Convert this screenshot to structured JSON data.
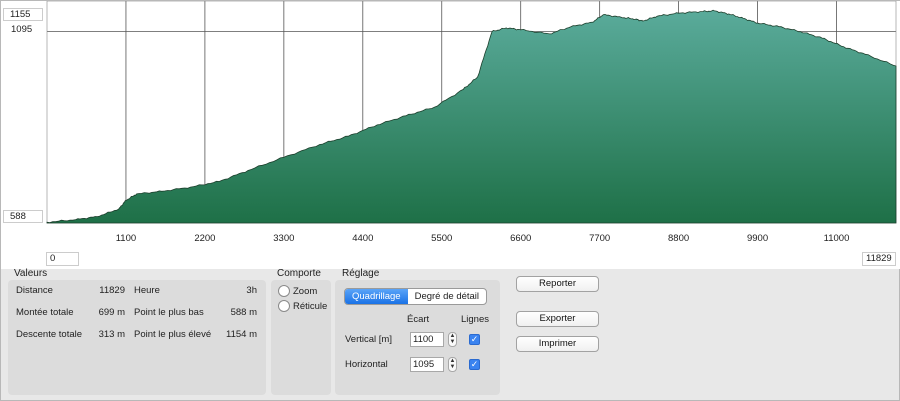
{
  "chart": {
    "y_top_label": "1155",
    "y_grid_label": "1095",
    "y_bottom_label": "588",
    "x_start_label": "0",
    "x_end_label": "11829",
    "colors": {
      "fill_top": "#5aab9b",
      "fill_bottom": "#1e7047",
      "grid": "#555555"
    }
  },
  "chart_data": {
    "type": "area",
    "xlim": [
      0,
      11829
    ],
    "ylim": [
      588,
      1155
    ],
    "x_ticks": [
      1100,
      2200,
      3300,
      4400,
      5500,
      6600,
      7700,
      8800,
      9900,
      11000
    ],
    "y_grid": [
      1095
    ],
    "grid": true,
    "x": [
      0,
      400,
      700,
      1000,
      1100,
      1250,
      1600,
      2000,
      2400,
      2800,
      3300,
      3800,
      4200,
      4600,
      5000,
      5400,
      5800,
      6000,
      6200,
      6400,
      6600,
      7000,
      7300,
      7600,
      7750,
      8000,
      8200,
      8300,
      8500,
      8800,
      9100,
      9300,
      9500,
      9700,
      9900,
      10200,
      10500,
      10800,
      11100,
      11400,
      11829
    ],
    "y": [
      590,
      597,
      605,
      625,
      648,
      665,
      672,
      683,
      698,
      727,
      762,
      796,
      818,
      848,
      872,
      895,
      942,
      975,
      1095,
      1105,
      1100,
      1089,
      1108,
      1120,
      1140,
      1133,
      1128,
      1123,
      1136,
      1144,
      1148,
      1150,
      1142,
      1130,
      1118,
      1108,
      1095,
      1078,
      1055,
      1035,
      1004
    ]
  },
  "values_panel": {
    "title": "Valeurs",
    "rows": [
      {
        "label1": "Distance",
        "value1": "11829",
        "label2": "Heure",
        "value2": "3h"
      },
      {
        "label1": "Montée totale",
        "value1": "699 m",
        "label2": "Point le plus bas",
        "value2": "588 m"
      },
      {
        "label1": "Descente totale",
        "value1": "313 m",
        "label2": "Point le plus élevé",
        "value2": "1154 m"
      }
    ]
  },
  "behavior_panel": {
    "title": "Comporte",
    "options": [
      "Zoom",
      "Réticule"
    ]
  },
  "settings_panel": {
    "title": "Réglage",
    "tabs": [
      "Quadrillage",
      "Degré de détail"
    ],
    "col_spacing": "Écart",
    "col_lines": "Lignes",
    "vertical_label": "Vertical [m]",
    "vertical_value": "1100",
    "horizontal_label": "Horizontal",
    "horizontal_value": "1095"
  },
  "buttons": {
    "report": "Reporter",
    "export": "Exporter",
    "print": "Imprimer"
  },
  "icons": {
    "checkbox": "checkmark-icon",
    "stepper": "stepper-arrows-icon"
  }
}
